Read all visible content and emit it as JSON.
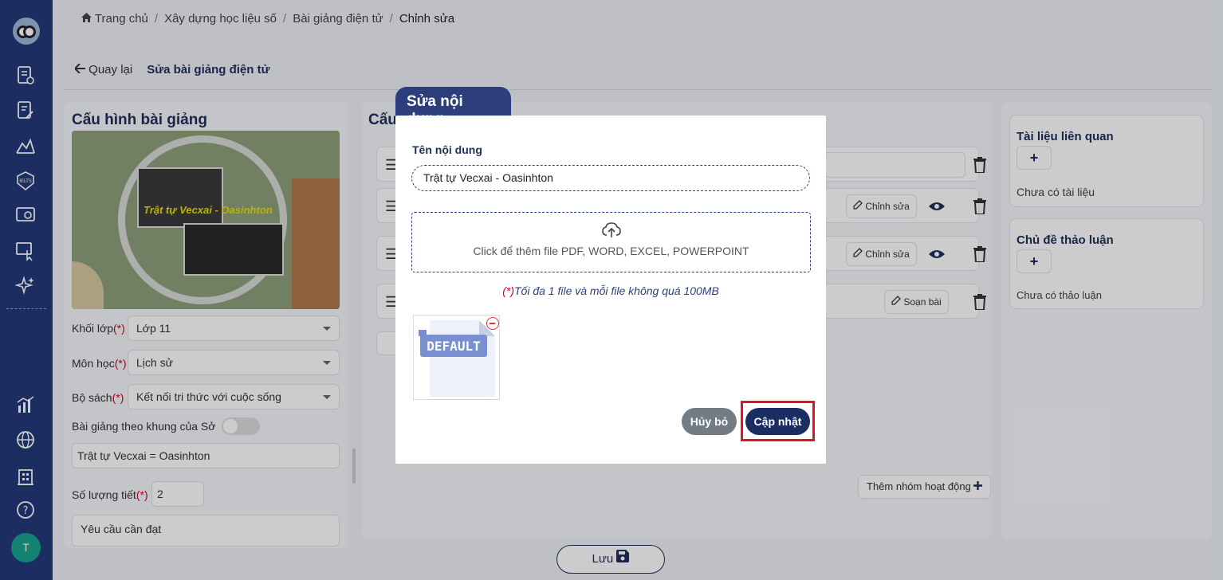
{
  "breadcrumb": {
    "home": "Trang chủ",
    "items": [
      "Xây dựng học liệu số",
      "Bài giảng điện tử"
    ],
    "current": "Chỉnh sửa"
  },
  "header": {
    "back_label": "Quay lại",
    "page_title": "Sửa bài giảng điện tử"
  },
  "left_panel": {
    "title": "Cấu hình bài giảng",
    "thumbnail_caption": "Trật tự Vecxai - Oasinhton",
    "grade_label": "Khối lớp",
    "grade_value": "Lớp 11",
    "subject_label": "Môn học",
    "subject_value": "Lịch sử",
    "book_label": "Bộ sách",
    "book_value": "Kết nối tri thức với cuộc sống",
    "framework_label": "Bài giảng theo khung của Sở",
    "lesson_name_value": "Trật tự Vecxai = Oasinhton",
    "periods_label": "Số lượng tiết",
    "periods_value": "2",
    "requirements_placeholder": "Yêu cầu cần đạt",
    "required_mark": "(*)"
  },
  "mid_panel": {
    "title": "Cấu",
    "edit_label": "Chỉnh sửa",
    "compose_label": "Soạn bài",
    "add_group_label": "Thêm nhóm hoạt động"
  },
  "right_panel": {
    "docs_title": "Tài liệu liên quan",
    "docs_empty": "Chưa có tài liệu",
    "discuss_title": "Chủ đề thảo luận",
    "discuss_empty": "Chưa có thảo luận",
    "plus": "+"
  },
  "save_label": "Lưu",
  "avatar_letter": "T",
  "modal": {
    "tab_title": "Sửa nội dung",
    "content_name_label": "Tên nội dung",
    "content_name_value": "Trật tự Vecxai - Oasinhton",
    "dropzone_text": "Click để thêm file PDF, WORD, EXCEL, POWERPOINT",
    "note_req": "(*)",
    "note_text": "Tối đa 1 file và mỗi file không quá 100MB",
    "file_badge": "DEFAULT",
    "cancel_label": "Hủy bỏ",
    "update_label": "Cập nhật"
  },
  "colors": {
    "sidebar": "#233a7a",
    "primary": "#1b2e63",
    "danger": "#e0151f",
    "avatar": "#1aa38d"
  }
}
